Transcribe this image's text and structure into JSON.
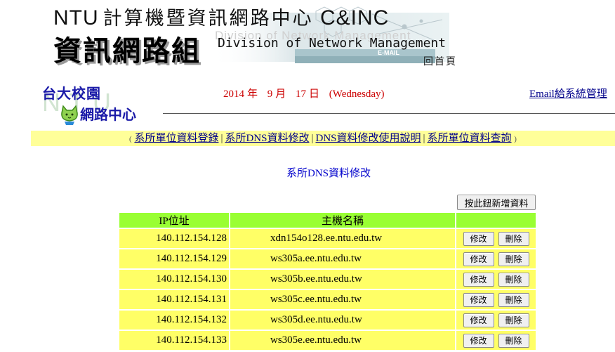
{
  "header": {
    "ntu_en": "NTU",
    "ntu_cn": "計算機暨資訊網路中心",
    "center_abbr": "C&INC",
    "dept_cn": "資訊網路組",
    "dept_en": "Division of Network Management",
    "home_link": "回首頁"
  },
  "logo": {
    "line1": "台大校園",
    "line2": "網路中心",
    "watermark": "NTU"
  },
  "date": {
    "year": "2014",
    "year_unit": "年",
    "month": "9",
    "month_unit": "月",
    "day": "17",
    "day_unit": "日",
    "weekday": "(Wednesday)"
  },
  "email_link": "Email給系統管理",
  "menu": {
    "open": "(",
    "close": ")",
    "sep": "|",
    "items": [
      {
        "label": "系所單位資料登錄"
      },
      {
        "label": "系所DNS資料修改"
      },
      {
        "label": "DNS資料修改使用說明"
      },
      {
        "label": "系所單位資料查詢"
      }
    ]
  },
  "page_title": "系所DNS資料修改",
  "add_button": "按此鈕新增資料",
  "table": {
    "headers": {
      "ip": "IP位址",
      "host": "主機名稱"
    },
    "edit_label": "修改",
    "delete_label": "刪除",
    "rows": [
      {
        "ip": "140.112.154.128",
        "host": "xdn154o128.ee.ntu.edu.tw"
      },
      {
        "ip": "140.112.154.129",
        "host": "ws305a.ee.ntu.edu.tw"
      },
      {
        "ip": "140.112.154.130",
        "host": "ws305b.ee.ntu.edu.tw"
      },
      {
        "ip": "140.112.154.131",
        "host": "ws305c.ee.ntu.edu.tw"
      },
      {
        "ip": "140.112.154.132",
        "host": "ws305d.ee.ntu.edu.tw"
      },
      {
        "ip": "140.112.154.133",
        "host": "ws305e.ee.ntu.edu.tw"
      }
    ]
  },
  "colors": {
    "menu_bg": "#ffff99",
    "table_header_bg": "#99ff33",
    "table_row_bg": "#ffff66",
    "date_color": "#cc0000",
    "link_color": "#00008b",
    "title_color": "#0000cc"
  }
}
